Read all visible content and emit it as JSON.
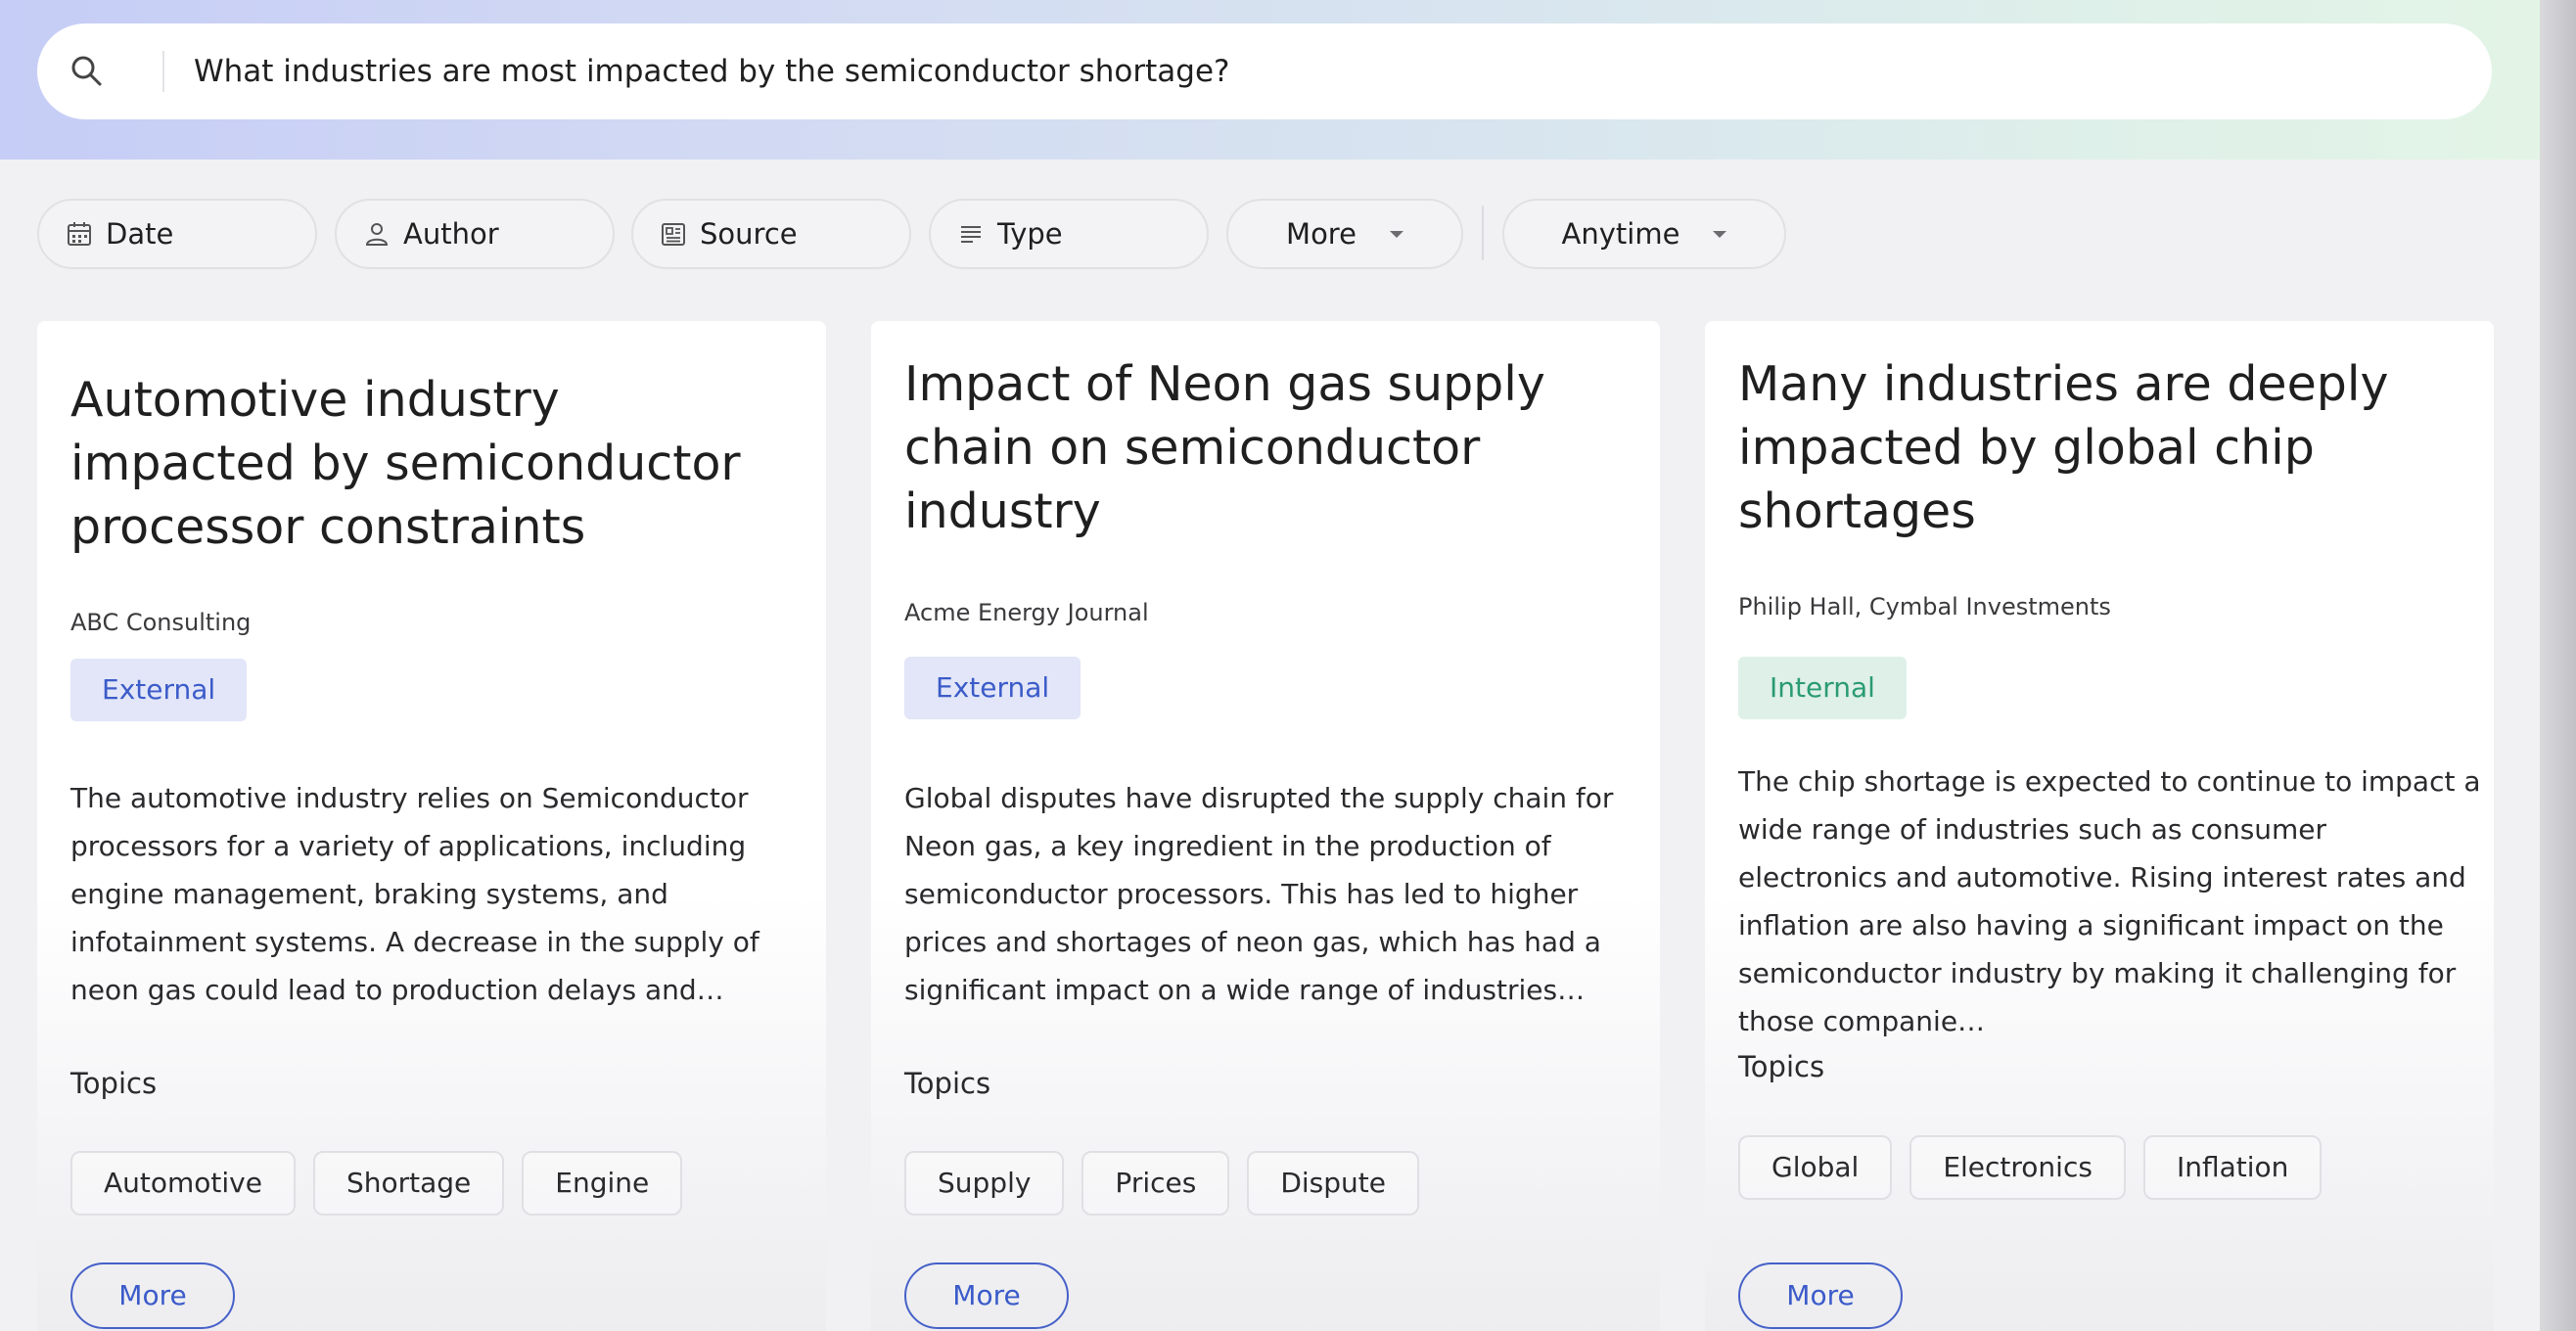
{
  "search": {
    "query": "What industries are most impacted by the semiconductor shortage?"
  },
  "filters": [
    {
      "label": "Date",
      "icon": "calendar-icon"
    },
    {
      "label": "Author",
      "icon": "person-icon"
    },
    {
      "label": "Source",
      "icon": "document-icon"
    },
    {
      "label": "Type",
      "icon": "lines-icon"
    },
    {
      "label": "More",
      "icon": "chevron-down-icon"
    },
    {
      "label": "Anytime",
      "icon": "chevron-down-icon"
    }
  ],
  "cards": [
    {
      "title": "Automotive industry impacted by semiconductor processor constraints",
      "source": "ABC Consulting",
      "badge": "External",
      "description": "The automotive industry relies on Semiconductor processors for a variety of applications, including engine management, braking systems, and infotainment systems. A decrease in the supply of neon gas could lead to production delays and…",
      "topics_label": "Topics",
      "topics": [
        "Automotive",
        "Shortage",
        "Engine"
      ],
      "more_label": "More"
    },
    {
      "title": "Impact of Neon gas supply chain on semiconductor industry",
      "source": "Acme Energy Journal",
      "badge": "External",
      "description": "Global disputes have disrupted the supply chain for Neon gas, a key ingredient in the production of semiconductor processors. This has led to higher prices and shortages of neon gas, which has had a significant impact on a wide range of industries…",
      "topics_label": "Topics",
      "topics": [
        "Supply",
        "Prices",
        "Dispute"
      ],
      "more_label": "More"
    },
    {
      "title": "Many industries are deeply impacted by global chip shortages",
      "source": "Philip Hall, Cymbal Investments",
      "badge": "Internal",
      "description": "The chip shortage is expected to continue to impact a wide range of industries such as consumer electronics and automotive.  Rising interest rates and inflation are also having a significant impact on the semiconductor industry by making it challenging for those companie…",
      "topics_label": "Topics",
      "topics": [
        "Global",
        "Electronics",
        "Inflation"
      ],
      "more_label": "More"
    }
  ],
  "colors": {
    "accent": "#3b5bc9",
    "external_badge_bg": "#e2e6f8",
    "internal_badge_bg": "#dff0e9",
    "internal_badge_text": "#2a9b72"
  }
}
